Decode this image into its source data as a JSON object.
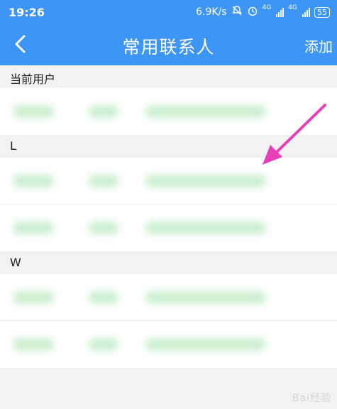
{
  "status_bar": {
    "time": "19:26",
    "speed": "6.9K/s",
    "net_type": "4G",
    "battery": "55"
  },
  "header": {
    "title": "常用联系人",
    "add_label": "添加"
  },
  "sections": [
    {
      "title": "当前用户"
    },
    {
      "title": "L"
    },
    {
      "title": "W"
    }
  ],
  "colors": {
    "header_bg": "#3d96f5",
    "annotation_arrow": "#e63fb8",
    "blurred_text": "#6bd07a"
  },
  "watermark": "Bai经验"
}
